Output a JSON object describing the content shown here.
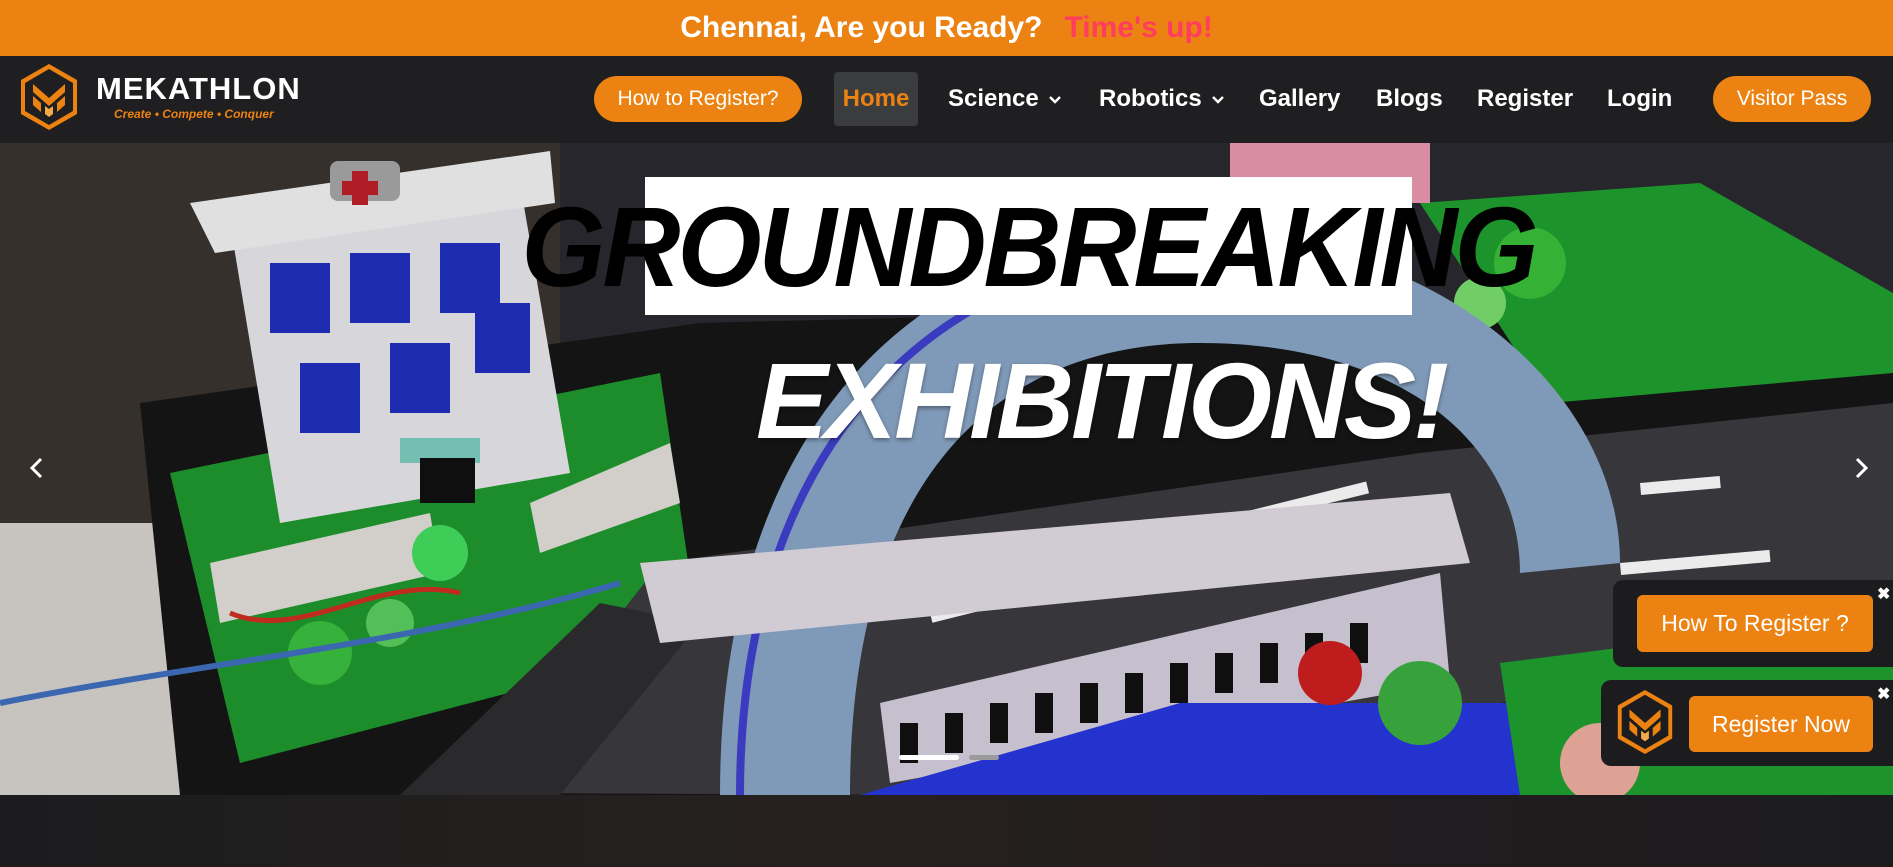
{
  "banner": {
    "text": "Chennai, Are you Ready?",
    "timer": "Time's up!"
  },
  "logo": {
    "name": "MEKATHLON",
    "tagline": "Create • Compete • Conquer"
  },
  "nav": {
    "how_to_register": "How to Register?",
    "home": "Home",
    "science": "Science",
    "robotics": "Robotics",
    "gallery": "Gallery",
    "blogs": "Blogs",
    "register": "Register",
    "login": "Login",
    "visitor_pass": "Visitor Pass"
  },
  "hero": {
    "headline_1": "GROUNDBREAKING",
    "headline_2": "EXHIBITIONS!",
    "active_slide": 1,
    "slide_count": 2
  },
  "widgets": {
    "how_to_register": "How To Register ?",
    "register_now": "Register Now",
    "close": "✖"
  },
  "colors": {
    "accent": "#ec8211",
    "timer": "#ff3e5e",
    "navbar": "#1f1f21"
  }
}
